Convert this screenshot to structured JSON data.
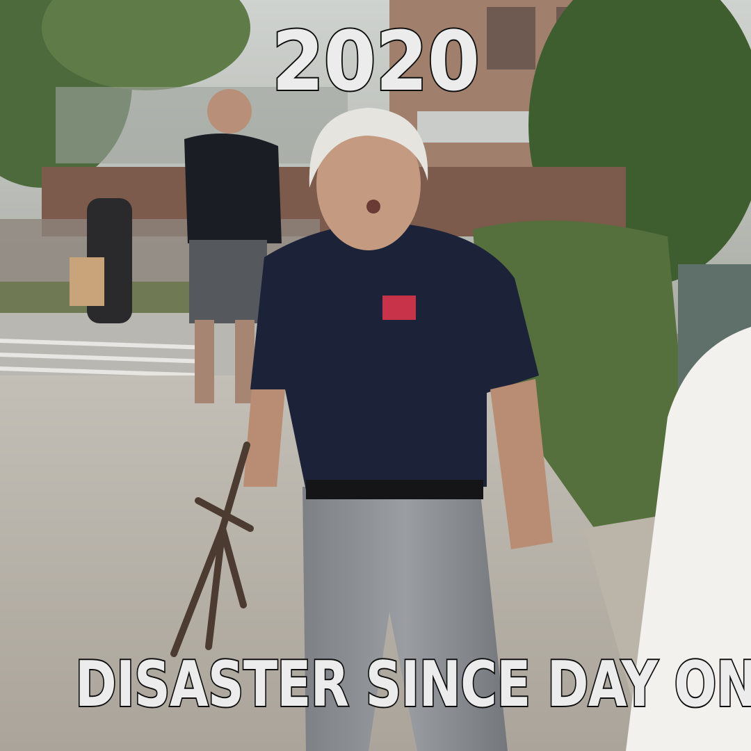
{
  "meme": {
    "top_text": "2020",
    "bottom_text": "DISASTER SINCE DAY ONE"
  },
  "photo": {
    "subject": "man-with-pitchfork",
    "colors": {
      "shirt": "#1c2238",
      "pants": "#8c8f93",
      "hair": "#e6e4df",
      "foliage": "#4f6a3a",
      "sidewalk": "#b7b1a6"
    }
  }
}
